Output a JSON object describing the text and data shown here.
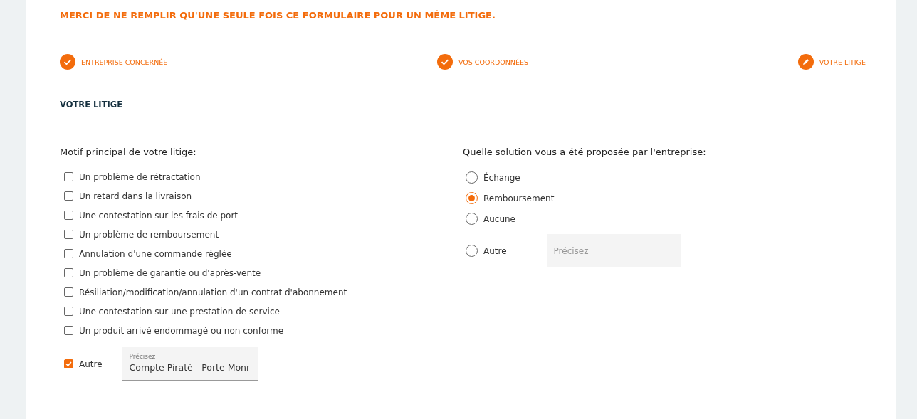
{
  "notice": "MERCI DE NE REMPLIR QU'UNE SEULE FOIS CE FORMULAIRE POUR UN MÊME LITIGE.",
  "steps": [
    {
      "label": "ENTREPRISE CONCERNÉE",
      "kind": "done"
    },
    {
      "label": "VOS COORDONNÉES",
      "kind": "done"
    },
    {
      "label": "VOTRE LITIGE",
      "kind": "current"
    }
  ],
  "section_title": "VOTRE LITIGE",
  "reason": {
    "question": "Motif principal de votre litige:",
    "options": [
      {
        "label": "Un problème de rétractation",
        "checked": false
      },
      {
        "label": "Un retard dans la livraison",
        "checked": false
      },
      {
        "label": "Une contestation sur les frais de port",
        "checked": false
      },
      {
        "label": "Un problème de remboursement",
        "checked": false
      },
      {
        "label": "Annulation d'une commande réglée",
        "checked": false
      },
      {
        "label": "Un problème de garantie ou d'après-vente",
        "checked": false
      },
      {
        "label": "Résiliation/modification/annulation d'un contrat d'abonnement",
        "checked": false
      },
      {
        "label": "Une contestation sur une prestation de service",
        "checked": false
      },
      {
        "label": "Un produit arrivé endommagé ou non conforme",
        "checked": false
      },
      {
        "label": "Autre",
        "checked": true,
        "field": {
          "label": "Précisez",
          "value": "Compte Piraté - Porte Monr"
        }
      }
    ]
  },
  "solution": {
    "question": "Quelle solution vous a été proposée par l'entreprise:",
    "options": [
      {
        "label": "Échange",
        "selected": false
      },
      {
        "label": "Remboursement",
        "selected": true
      },
      {
        "label": "Aucune",
        "selected": false
      },
      {
        "label": "Autre",
        "selected": false,
        "field": {
          "placeholder": "Précisez"
        }
      }
    ]
  }
}
